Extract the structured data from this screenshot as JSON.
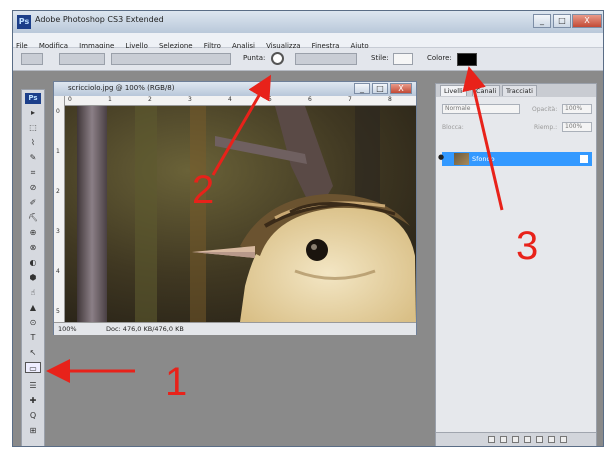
{
  "window": {
    "title": "Adobe Photoshop CS3 Extended",
    "buttons": [
      "_",
      "□",
      "X"
    ]
  },
  "menu": [
    "File",
    "Modifica",
    "Immagine",
    "Livello",
    "Selezione",
    "Filtro",
    "Analisi",
    "Visualizza",
    "Finestra",
    "Aiuto"
  ],
  "options": {
    "brush_label": "Punta:",
    "style_label": "Stile:",
    "color_label": "Colore:",
    "color_value": "#000000"
  },
  "document": {
    "title": "scricciolo.jpg @ 100% (RGB/8)",
    "zoom": "100%",
    "doc_info": "Doc: 476,0 KB/476,0 KB",
    "ruler_h": [
      "0",
      "1",
      "2",
      "3",
      "4",
      "5",
      "6",
      "7",
      "8"
    ],
    "ruler_v": [
      "0",
      "1",
      "2",
      "3",
      "4",
      "5"
    ]
  },
  "tools": [
    "Ps",
    "▸",
    "⬚",
    "⌇",
    "✎",
    "⌗",
    "⊘",
    "✐",
    "⛏",
    "⊕",
    "⊗",
    "◐",
    "⬢",
    "☝",
    "▲",
    "⊙",
    "T",
    "↖",
    "▭",
    "☰",
    "✚",
    "Q",
    "⊞"
  ],
  "layers_panel": {
    "tabs": [
      "Livelli",
      "Canali",
      "Tracciati"
    ],
    "blend_mode": "Normale",
    "opacity_label": "Opacità:",
    "opacity_value": "100%",
    "lock_label": "Blocca:",
    "fill_label": "Riemp.:",
    "fill_value": "100%",
    "layer_name": "Sfondo"
  },
  "annotations": [
    "1",
    "2",
    "3"
  ],
  "colors": {
    "annotation": "#e8221a",
    "selected_layer": "#3399ff",
    "title_bar": "#b9c8da"
  }
}
